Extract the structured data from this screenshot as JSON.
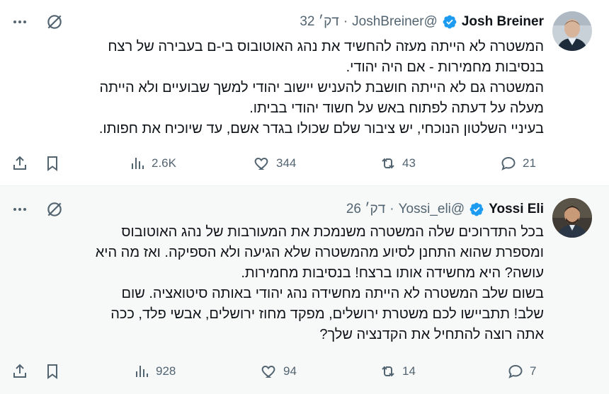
{
  "tweets": [
    {
      "name": "Josh Breiner",
      "handle": "@JoshBreiner",
      "dot": "·",
      "time": "דק׳ 32",
      "lines": [
        "המשטרה לא הייתה מעזה להחשיד את נהג האוטובוס בי-ם בעבירה של רצח",
        "בנסיבות מחמירות - אם היה יהודי.",
        "המשטרה גם לא הייתה חושבת להעניש יישוב יהודי למשך שבועיים ולא הייתה",
        "מעלה על דעתה לפתוח באש על חשוד יהודי בביתו.",
        "בעיניי השלטון הנוכחי, יש ציבור שלם שכולו בגדר אשם, עד שיוכיח את חפותו."
      ],
      "views": "2.6K",
      "likes": "344",
      "reposts": "43",
      "replies": "21"
    },
    {
      "name": "Yossi Eli",
      "handle": "@Yossi_eli",
      "dot": "·",
      "time": "דק׳ 26",
      "lines": [
        "בכל התדרוכים שלה המשטרה משנמכת את המעורבות של נהג האוטובוס",
        "ומספרת שהוא התחנן לסיוע מהמשטרה שלא הגיעה ולא הספיקה. ואז מה היא",
        "עושה? היא מחשידה אותו ברצח! בנסיבות מחמירות.",
        "בשום שלב המשטרה לא הייתה מחשידה נהג יהודי באותה סיטואציה. שום",
        "שלב! תתביישו לכם משטרת ירושלים, מפקד מחוז ירושלים, אבשי פלד, ככה",
        "אתה רוצה להתחיל את הקדנציה שלך?"
      ],
      "views": "928",
      "likes": "94",
      "reposts": "14",
      "replies": "7"
    }
  ],
  "colors": {
    "accent": "#1d9bf0",
    "text": "#0f1419",
    "muted": "#536471",
    "hover_bg": "#f7f9f9"
  },
  "icons": [
    "verified-badge-icon",
    "grok-icon",
    "more-icon",
    "share-icon",
    "bookmark-icon",
    "views-icon",
    "like-icon",
    "repost-icon",
    "reply-icon"
  ]
}
